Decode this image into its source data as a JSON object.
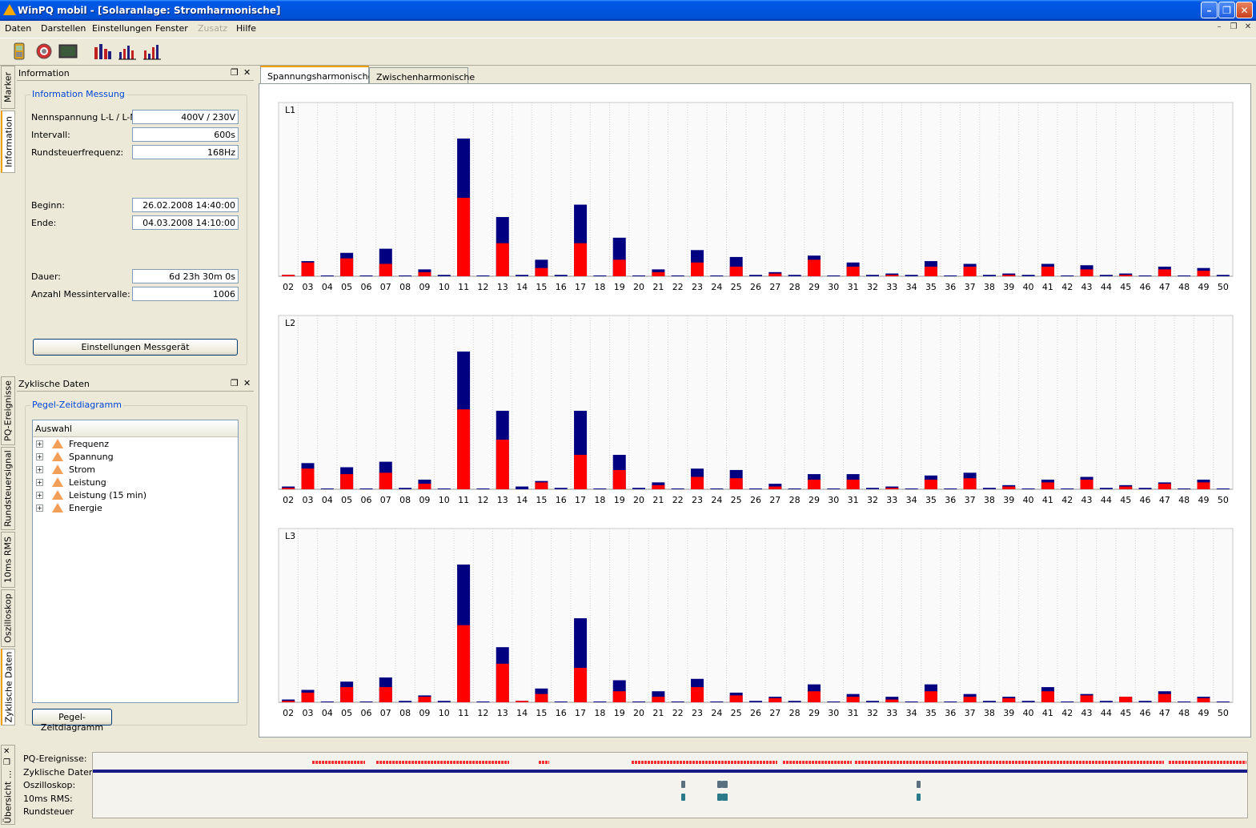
{
  "window": {
    "title": "WinPQ mobil - [Solaranlage: Stromharmonische]"
  },
  "menu": [
    "Daten",
    "Darstellen",
    "Einstellungen",
    "Fenster",
    "Zusatz",
    "Hilfe"
  ],
  "side_tabs_top": [
    "Marker",
    "Information"
  ],
  "side_tabs_bottom": [
    "PQ-Ereignisse",
    "Rundsteuersignal",
    "10ms RMS",
    "Oszilloskop",
    "Zyklische Daten"
  ],
  "info_panel": {
    "title": "Information",
    "group_title": "Information Messung",
    "fields": [
      {
        "label": "Nennspannung L-L / L-N:",
        "value": "400V / 230V"
      },
      {
        "label": "Intervall:",
        "value": "600s"
      },
      {
        "label": "Rundsteuerfrequenz:",
        "value": "168Hz"
      },
      {
        "label": "Beginn:",
        "value": "26.02.2008 14:40:00"
      },
      {
        "label": "Ende:",
        "value": "04.03.2008 14:10:00"
      },
      {
        "label": "Dauer:",
        "value": "6d 23h 30m 0s"
      },
      {
        "label": "Anzahl Messintervalle:",
        "value": "1006"
      }
    ],
    "button": "Einstellungen Messgerät"
  },
  "cyclic_panel": {
    "title": "Zyklische Daten",
    "group_title": "Pegel-Zeitdiagramm",
    "tree_header": "Auswahl",
    "tree_items": [
      "Frequenz",
      "Spannung",
      "Strom",
      "Leistung",
      "Leistung (15 min)",
      "Energie"
    ],
    "button": "Pegel-Zeitdiagramm"
  },
  "main_tabs": [
    "Spannungsharmonische",
    "Zwischenharmonische"
  ],
  "overview": {
    "tab": "Übersicht ...",
    "rows": [
      "PQ-Ereignisse:",
      "Zyklische Daten:",
      "Oszilloskop:",
      "10ms RMS:",
      "Rundsteuer"
    ]
  },
  "colors": {
    "red": "#ff0000",
    "blue": "#000080",
    "accent": "#f0a000"
  },
  "chart_data": [
    {
      "type": "bar",
      "title": "L1",
      "categories": [
        "02",
        "03",
        "04",
        "05",
        "06",
        "07",
        "08",
        "09",
        "10",
        "11",
        "12",
        "13",
        "14",
        "15",
        "16",
        "17",
        "18",
        "19",
        "20",
        "21",
        "22",
        "23",
        "24",
        "25",
        "26",
        "27",
        "28",
        "29",
        "30",
        "31",
        "32",
        "33",
        "34",
        "35",
        "36",
        "37",
        "38",
        "39",
        "40",
        "41",
        "42",
        "43",
        "44",
        "45",
        "46",
        "47",
        "48",
        "49",
        "50"
      ],
      "series": [
        {
          "values": [
            1,
            10,
            0,
            13,
            0,
            9,
            0,
            3,
            0,
            57,
            0,
            24,
            0,
            6,
            0,
            24,
            0,
            12,
            0,
            3,
            0,
            10,
            0,
            7,
            0,
            2,
            0,
            12,
            0,
            7,
            0,
            1,
            0,
            7,
            0,
            7,
            0,
            1,
            0,
            7,
            0,
            5,
            0,
            1,
            0,
            5,
            0,
            4,
            0
          ]
        },
        {
          "values": [
            1,
            11,
            0,
            17,
            0,
            20,
            0,
            5,
            1,
            100,
            0,
            43,
            1,
            12,
            1,
            52,
            0,
            28,
            0,
            5,
            0,
            19,
            0,
            14,
            1,
            3,
            1,
            15,
            0,
            10,
            1,
            2,
            1,
            11,
            0,
            9,
            1,
            2,
            1,
            9,
            0,
            8,
            1,
            2,
            0,
            7,
            0,
            6,
            1
          ]
        }
      ],
      "ylim": [
        0,
        100
      ]
    },
    {
      "type": "bar",
      "title": "L2",
      "categories": [
        "02",
        "03",
        "04",
        "05",
        "06",
        "07",
        "08",
        "09",
        "10",
        "11",
        "12",
        "13",
        "14",
        "15",
        "16",
        "17",
        "18",
        "19",
        "20",
        "21",
        "22",
        "23",
        "24",
        "25",
        "26",
        "27",
        "28",
        "29",
        "30",
        "31",
        "32",
        "33",
        "34",
        "35",
        "36",
        "37",
        "38",
        "39",
        "40",
        "41",
        "42",
        "43",
        "44",
        "45",
        "46",
        "47",
        "48",
        "49",
        "50"
      ],
      "series": [
        {
          "values": [
            1,
            15,
            0,
            11,
            0,
            12,
            0,
            4,
            0,
            58,
            0,
            36,
            0,
            5,
            0,
            25,
            0,
            14,
            0,
            3,
            0,
            9,
            0,
            8,
            0,
            2,
            0,
            7,
            0,
            7,
            0,
            1,
            0,
            7,
            0,
            8,
            0,
            2,
            0,
            5,
            0,
            7,
            0,
            2,
            0,
            4,
            0,
            5,
            0
          ]
        },
        {
          "values": [
            2,
            19,
            0,
            16,
            0,
            20,
            1,
            7,
            0,
            100,
            0,
            57,
            2,
            6,
            1,
            57,
            0,
            25,
            1,
            5,
            0,
            15,
            0,
            14,
            0,
            4,
            0,
            11,
            0,
            11,
            1,
            2,
            0,
            10,
            0,
            12,
            1,
            3,
            0,
            7,
            0,
            9,
            1,
            3,
            1,
            5,
            0,
            7,
            0
          ]
        }
      ],
      "ylim": [
        0,
        100
      ]
    },
    {
      "type": "bar",
      "title": "L3",
      "categories": [
        "02",
        "03",
        "04",
        "05",
        "06",
        "07",
        "08",
        "09",
        "10",
        "11",
        "12",
        "13",
        "14",
        "15",
        "16",
        "17",
        "18",
        "19",
        "20",
        "21",
        "22",
        "23",
        "24",
        "25",
        "26",
        "27",
        "28",
        "29",
        "30",
        "31",
        "32",
        "33",
        "34",
        "35",
        "36",
        "37",
        "38",
        "39",
        "40",
        "41",
        "42",
        "43",
        "44",
        "45",
        "46",
        "47",
        "48",
        "49",
        "50"
      ],
      "series": [
        {
          "values": [
            1,
            7,
            0,
            11,
            0,
            11,
            0,
            4,
            0,
            56,
            0,
            28,
            1,
            6,
            0,
            25,
            0,
            8,
            0,
            4,
            0,
            11,
            0,
            5,
            0,
            3,
            0,
            8,
            0,
            4,
            0,
            2,
            0,
            8,
            0,
            4,
            0,
            3,
            0,
            8,
            0,
            5,
            0,
            4,
            0,
            6,
            0,
            3,
            0
          ]
        },
        {
          "values": [
            2,
            9,
            0,
            15,
            0,
            18,
            1,
            5,
            1,
            100,
            0,
            40,
            1,
            10,
            0,
            61,
            0,
            16,
            0,
            8,
            0,
            17,
            0,
            7,
            1,
            4,
            1,
            13,
            0,
            6,
            1,
            4,
            0,
            13,
            0,
            6,
            1,
            4,
            1,
            11,
            0,
            6,
            1,
            4,
            1,
            8,
            0,
            4,
            0
          ]
        }
      ],
      "ylim": [
        0,
        100
      ]
    }
  ]
}
